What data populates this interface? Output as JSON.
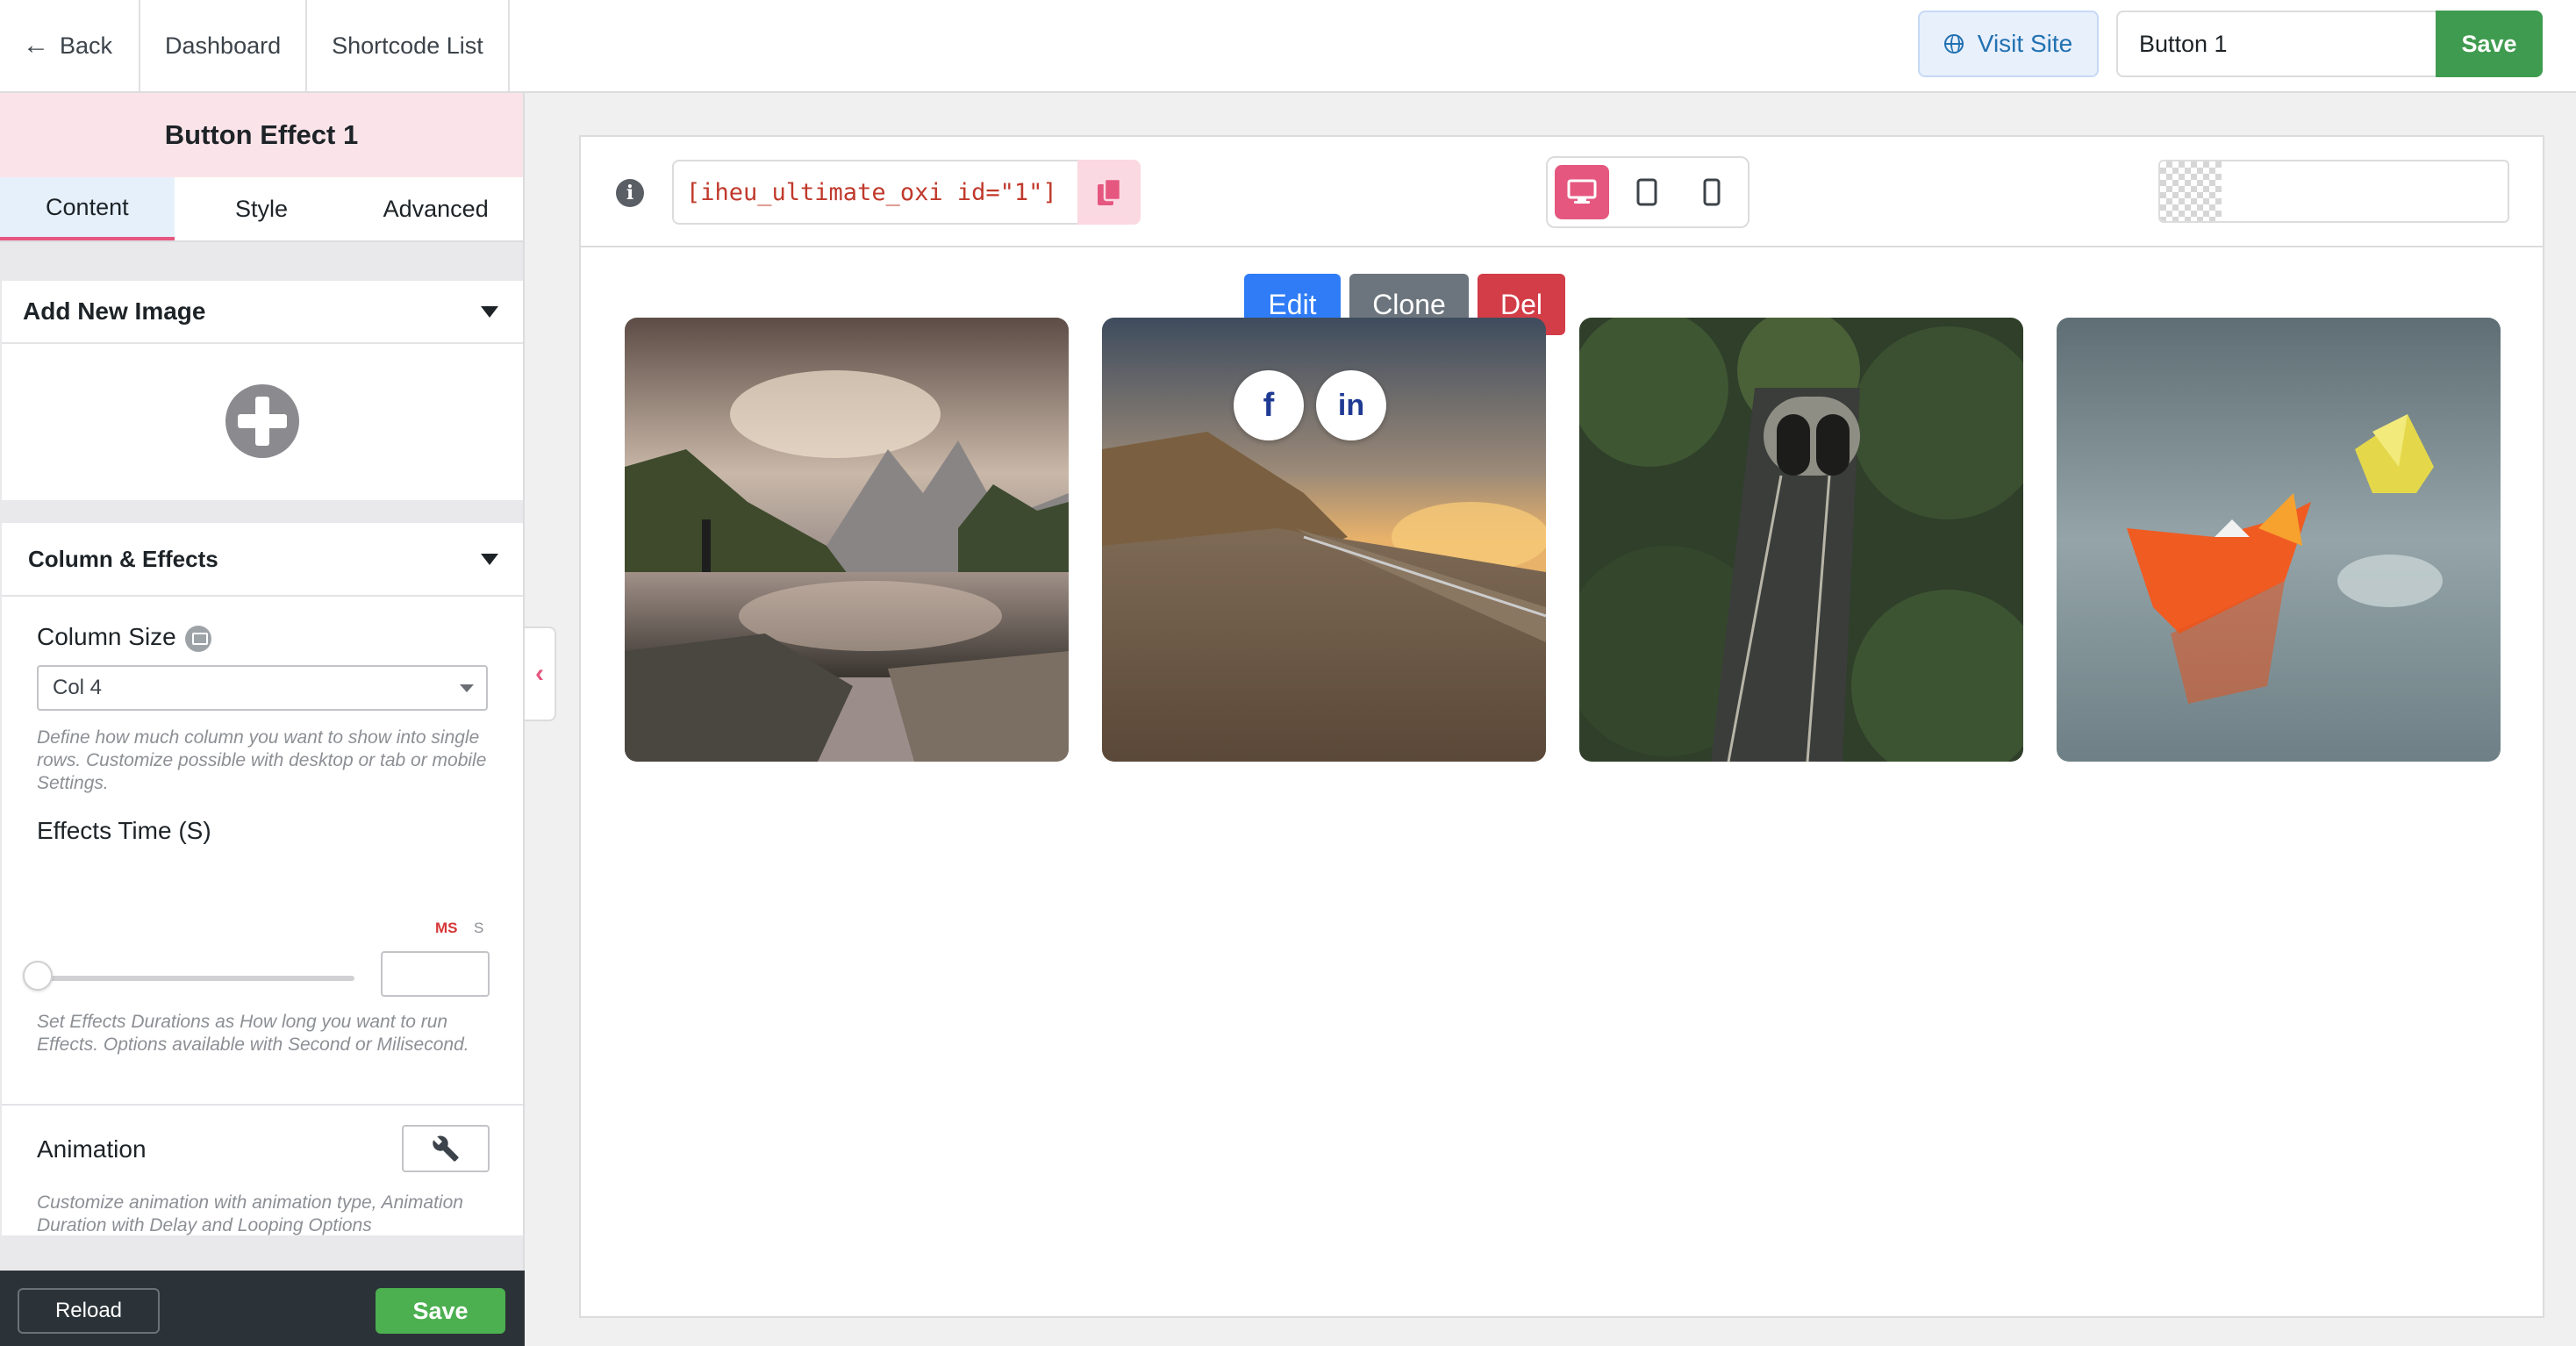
{
  "topbar": {
    "back_label": "Back",
    "nav": [
      "Dashboard",
      "Shortcode List"
    ],
    "visit_site_label": "Visit Site",
    "name_value": "Button 1",
    "save_label": "Save"
  },
  "panel": {
    "title": "Button Effect 1",
    "tabs": [
      "Content",
      "Style",
      "Advanced"
    ],
    "active_tab": "Content",
    "add_image": {
      "title": "Add New Image"
    },
    "column_effects": {
      "title": "Column & Effects",
      "column_size": {
        "label": "Column Size",
        "value": "Col 4",
        "description": "Define how much column you want to show into single rows. Customize possible with desktop or tab or mobile Settings."
      },
      "effects_time": {
        "label": "Effects Time (S)",
        "unit_ms": "MS",
        "unit_s": "S",
        "slider_value": 0,
        "input_value": "",
        "description": "Set Effects Durations as How long you want to run Effects. Options available with Second or Milisecond."
      },
      "animation": {
        "label": "Animation",
        "description": "Customize animation with animation type, Animation Duration with Delay and Looping Options"
      }
    },
    "reload_label": "Reload",
    "save_label": "Save"
  },
  "preview": {
    "shortcode": "[iheu_ultimate_oxi id=\"1\"]",
    "active_device": "desktop",
    "actions": {
      "edit": "Edit",
      "clone": "Clone",
      "del": "Del"
    }
  },
  "colors": {
    "accent": "#e5577f",
    "save_green": "#3f9b4f",
    "edit_blue": "#2f7cf6",
    "clone_gray": "#6c757d",
    "del_red": "#d23d47"
  }
}
